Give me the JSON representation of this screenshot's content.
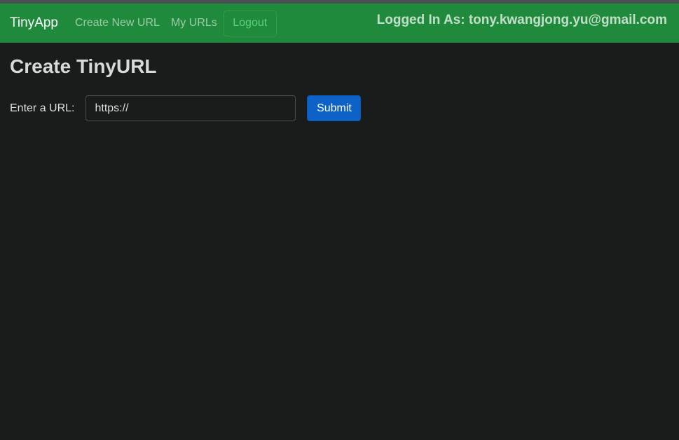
{
  "navbar": {
    "brand": "TinyApp",
    "links": [
      {
        "label": "Create New URL"
      },
      {
        "label": "My URLs"
      }
    ],
    "logout_label": "Logout",
    "logged_in_text": "Logged In As: tony.kwangjong.yu@gmail.com"
  },
  "main": {
    "title": "Create TinyURL",
    "url_label": "Enter a URL:",
    "url_value": "https://",
    "submit_label": "Submit"
  },
  "colors": {
    "navbar_bg": "#208a3c",
    "page_bg": "#1a1b1b",
    "submit_bg": "#0d62c8",
    "logout_text": "#5ad07a"
  }
}
